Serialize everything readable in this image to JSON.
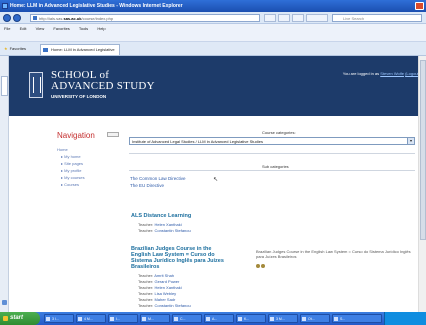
{
  "browser": {
    "title": "Home: LLM in Advanced Legislative Studies - Windows Internet Explorer",
    "address": {
      "prefix": "http://ials.sas.",
      "host": "sas.ac.uk",
      "suffix": "/course/index.php"
    },
    "search_placeholder": "Live Search",
    "menu": [
      "File",
      "Edit",
      "View",
      "Favorites",
      "Tools",
      "Help"
    ],
    "favorites_label": "Favorites",
    "tab_title": "Home: LLM in Advanced Legislative Studies"
  },
  "header": {
    "school_line1": "SCHOOL of",
    "school_line2": "ADVANCED STUDY",
    "university": "UNIVERSITY OF LONDON",
    "login_prefix": "You are logged in as",
    "login_user": "Steven Wolfe",
    "logout_label": "(Logout)"
  },
  "navigation": {
    "title": "Navigation",
    "items": [
      {
        "label": "Home",
        "indent": false
      },
      {
        "label": "My home",
        "indent": true
      },
      {
        "label": "Site pages",
        "indent": true
      },
      {
        "label": "My profile",
        "indent": true
      },
      {
        "label": "My courses",
        "indent": true
      },
      {
        "label": "Courses",
        "indent": true
      }
    ]
  },
  "main": {
    "course_categories_label": "Course categories:",
    "selected_category": "Institute of Advanced Legal Studies / LLM in Advanced Legislative Studies",
    "sub_categories_label": "Sub categories",
    "sub_categories": [
      "The Common Law Directive",
      "The EU Directive"
    ],
    "courses": [
      {
        "title": "ALS Distance Learning",
        "teacher_label": "Teacher:",
        "teachers": [
          "Helen Xanthaki",
          "Constantin Stefanou"
        ]
      },
      {
        "title_lines": [
          "Brazilian Judges Course in the",
          "English Law System = Curso do",
          "Sistema Jurídico Inglês para Juízes",
          "Brasileiros"
        ],
        "teacher_label": "Teacher:",
        "teachers": [
          "Amrit Shah",
          "Gerard Power",
          "Helen Xanthaki",
          "Lisa Webley",
          "Maher Sadr",
          "Constantin Stefanou"
        ],
        "summary": "Brazilian Judges Course in the English Law System = Curso do Sistema Jurídico Inglês para Juízes Brasileiros"
      }
    ]
  },
  "taskbar": {
    "start_label": "start",
    "items": [
      "3 I...",
      "4 M...",
      "I...",
      "M...",
      "C...",
      "A...",
      "K...",
      "3 M...",
      "Ot...",
      "S..."
    ]
  }
}
